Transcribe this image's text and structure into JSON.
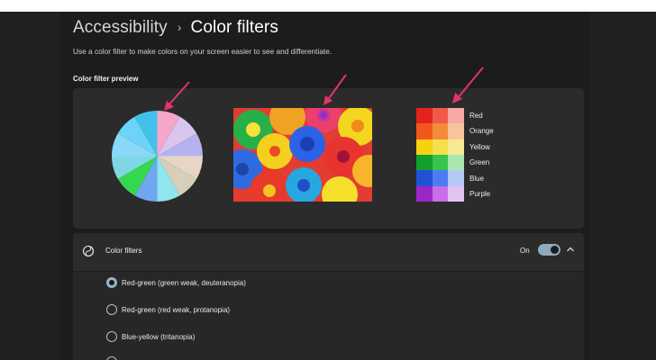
{
  "breadcrumb": {
    "parent": "Accessibility",
    "separator": "›",
    "current": "Color filters"
  },
  "description": "Use a color filter to make colors on your screen easier to see and differentiate.",
  "preview": {
    "title": "Color filter preview",
    "pie_colors": [
      "#f4a7c8",
      "#d8c6ee",
      "#b6b2f0",
      "#e7d6c6",
      "#d7cfb9",
      "#8fe6ee",
      "#6fa7ef",
      "#34d84f",
      "#7fd7e4",
      "#8ad8f8",
      "#6cd4f8",
      "#43c1ea"
    ],
    "swatches": [
      [
        "#e4231f",
        "#f05a4b",
        "#f6a9a7"
      ],
      [
        "#f2581c",
        "#f48a3c",
        "#f8c49b"
      ],
      [
        "#f6d211",
        "#f7df4b",
        "#f7ea93"
      ],
      [
        "#119f2e",
        "#37c44f",
        "#a8e7ad"
      ],
      [
        "#1f52d6",
        "#4d7cf0",
        "#b3c8f5"
      ],
      [
        "#9c27c8",
        "#c86ee6",
        "#e1c3f2"
      ]
    ],
    "color_names": [
      "Red",
      "Orange",
      "Yellow",
      "Green",
      "Blue",
      "Purple"
    ]
  },
  "filters": {
    "title": "Color filters",
    "toggle_state": "On",
    "accent": "#99b4c8",
    "options": [
      {
        "label": "Red-green (green weak, deuteranopia)",
        "selected": true
      },
      {
        "label": "Red-green (red weak, protanopia)",
        "selected": false
      },
      {
        "label": "Blue-yellow (tritanopia)",
        "selected": false
      },
      {
        "label": "",
        "selected": false
      }
    ]
  }
}
